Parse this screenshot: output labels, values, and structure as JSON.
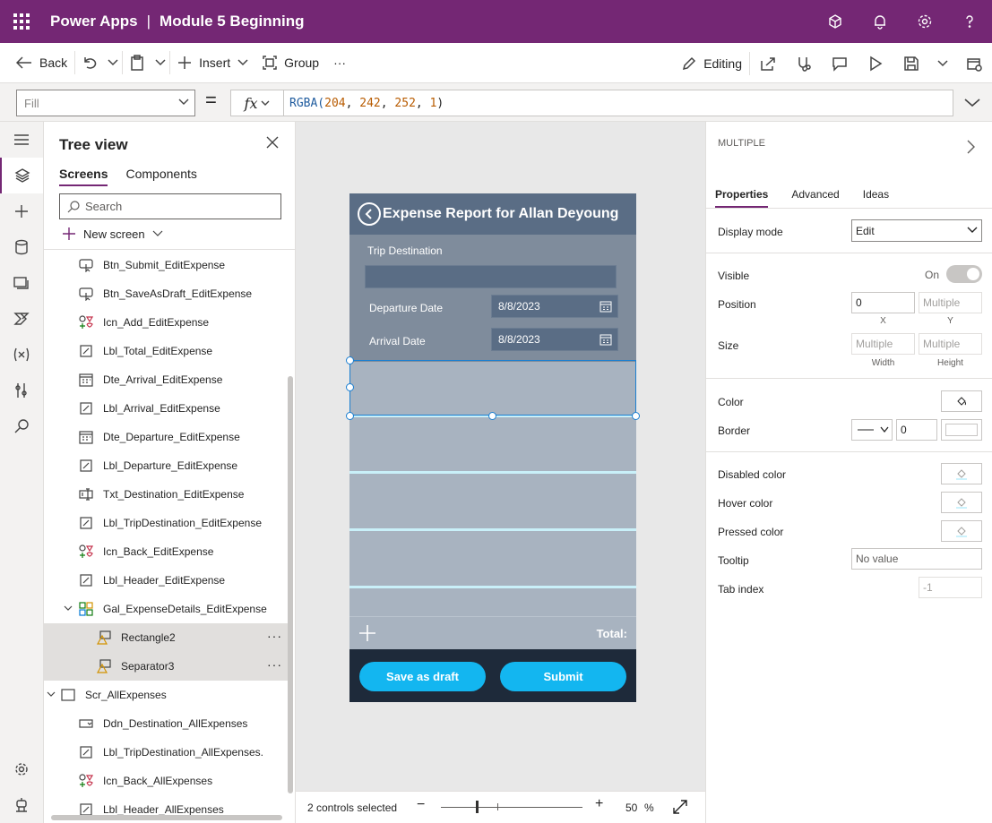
{
  "topbar": {
    "app": "Power Apps",
    "separator": "|",
    "title": "Module 5 Beginning",
    "icons": [
      "environment-icon",
      "bell-icon",
      "gear-icon",
      "help-icon"
    ]
  },
  "cmdbar": {
    "back": "Back",
    "insert": "Insert",
    "group": "Group",
    "more": "···",
    "editing": "Editing"
  },
  "formula": {
    "property": "Fill",
    "equals": "=",
    "fx": "fx",
    "fn": "RGBA(",
    "args": [
      "204",
      "242",
      "252",
      "1"
    ],
    "close": ")"
  },
  "tree": {
    "title": "Tree view",
    "tabs": [
      "Screens",
      "Components"
    ],
    "search_placeholder": "Search",
    "new_screen": "New screen",
    "nodes": [
      {
        "label": "Btn_Submit_EditExpense",
        "icon": "button-icon"
      },
      {
        "label": "Btn_SaveAsDraft_EditExpense",
        "icon": "button-icon"
      },
      {
        "label": "Icn_Add_EditExpense",
        "icon": "icon-control-icon"
      },
      {
        "label": "Lbl_Total_EditExpense",
        "icon": "label-icon"
      },
      {
        "label": "Dte_Arrival_EditExpense",
        "icon": "calendar-icon"
      },
      {
        "label": "Lbl_Arrival_EditExpense",
        "icon": "label-icon"
      },
      {
        "label": "Dte_Departure_EditExpense",
        "icon": "calendar-icon"
      },
      {
        "label": "Lbl_Departure_EditExpense",
        "icon": "label-icon"
      },
      {
        "label": "Txt_Destination_EditExpense",
        "icon": "textinput-icon"
      },
      {
        "label": "Lbl_TripDestination_EditExpense",
        "icon": "label-icon"
      },
      {
        "label": "Icn_Back_EditExpense",
        "icon": "icon-control-icon"
      },
      {
        "label": "Lbl_Header_EditExpense",
        "icon": "label-icon"
      },
      {
        "label": "Gal_ExpenseDetails_EditExpense",
        "icon": "gallery-icon"
      },
      {
        "label": "Rectangle2",
        "icon": "shape-icon"
      },
      {
        "label": "Separator3",
        "icon": "shape-icon"
      },
      {
        "label": "Scr_AllExpenses",
        "icon": "screen-icon"
      },
      {
        "label": "Ddn_Destination_AllExpenses",
        "icon": "dropdown-icon"
      },
      {
        "label": "Lbl_TripDestination_AllExpenses.",
        "icon": "label-icon"
      },
      {
        "label": "Icn_Back_AllExpenses",
        "icon": "icon-control-icon"
      },
      {
        "label": "Lbl_Header_AllExpenses",
        "icon": "label-icon"
      }
    ],
    "more": "···"
  },
  "phone": {
    "title": "Expense Report for Allan Deyoung",
    "trip_destination": "Trip Destination",
    "departure_label": "Departure Date",
    "departure_value": "8/8/2023",
    "arrival_label": "Arrival Date",
    "arrival_value": "8/8/2023",
    "total": "Total:",
    "save_draft": "Save as draft",
    "submit": "Submit"
  },
  "status": {
    "selected": "2 controls selected",
    "zoom": "50",
    "pct": "%",
    "zoom_level": 0.25
  },
  "props": {
    "header": "MULTIPLE",
    "tabs": [
      "Properties",
      "Advanced",
      "Ideas"
    ],
    "display_mode_label": "Display mode",
    "display_mode_value": "Edit",
    "visible_label": "Visible",
    "visible_value": "On",
    "position_label": "Position",
    "pos_x": "0",
    "pos_y": "Multiple",
    "x_label": "X",
    "y_label": "Y",
    "size_label": "Size",
    "width_value": "Multiple",
    "height_value": "Multiple",
    "width_label": "Width",
    "height_label": "Height",
    "color_label": "Color",
    "border_label": "Border",
    "border_width": "0",
    "disabled_color_label": "Disabled color",
    "hover_color_label": "Hover color",
    "pressed_color_label": "Pressed color",
    "tooltip_label": "Tooltip",
    "tooltip_placeholder": "No value",
    "tab_index_label": "Tab index",
    "tab_index_value": "-1"
  },
  "colors": {
    "brand": "#742774",
    "phone_header": "#5a6d85",
    "gallery_fill": "#a8b3c0",
    "separator_fill": "#ccf2fc",
    "button": "#13b6f0"
  }
}
